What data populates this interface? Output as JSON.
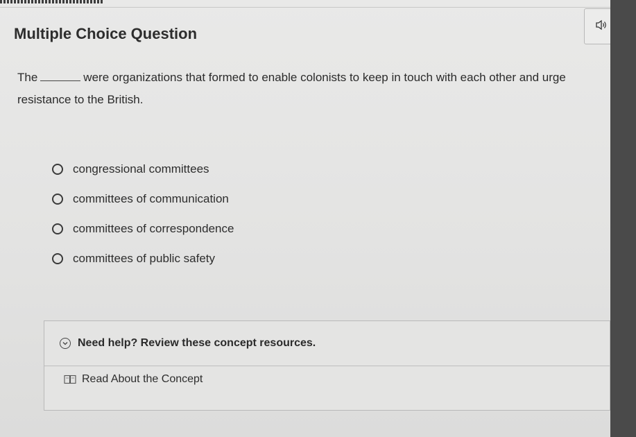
{
  "question": {
    "title": "Multiple Choice Question",
    "prompt_start": "The",
    "prompt_end": "were organizations that formed to enable colonists to keep in touch with each other and urge resistance to the British."
  },
  "options": [
    {
      "label": "congressional committees"
    },
    {
      "label": "committees of communication"
    },
    {
      "label": "committees of correspondence"
    },
    {
      "label": "committees of public safety"
    }
  ],
  "help": {
    "label": "Need help? Review these concept resources.",
    "resource_label": "Read About the Concept"
  },
  "icons": {
    "audio": "speaker-icon",
    "help": "chevron-down-icon",
    "resource": "book-icon"
  }
}
